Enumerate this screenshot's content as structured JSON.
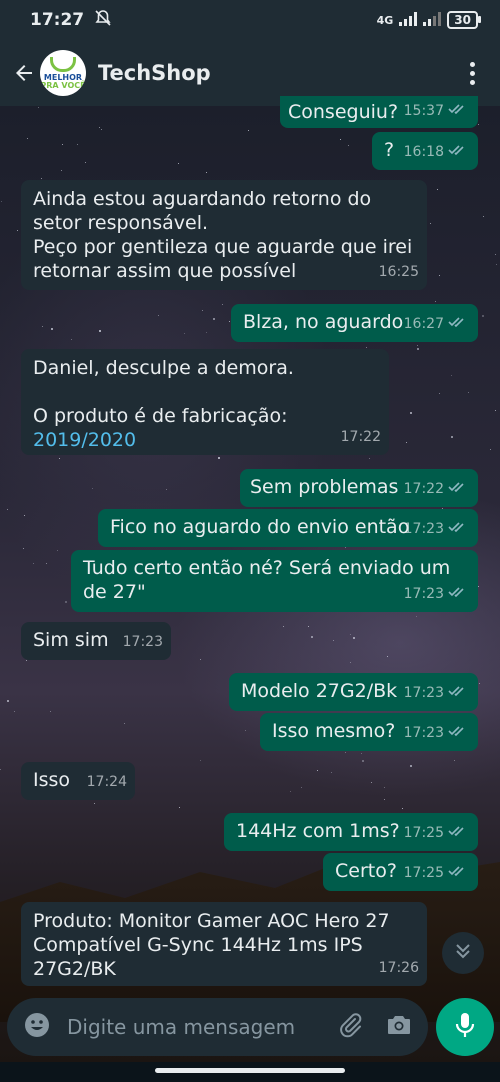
{
  "status_bar": {
    "time": "17:27",
    "network": "4G",
    "battery": "30"
  },
  "header": {
    "contact_name": "TechShop",
    "avatar_line1": "MELHOR",
    "avatar_line2": "PRA VOCÊ"
  },
  "messages": [
    {
      "dir": "out",
      "text": "Conseguiu?",
      "time": "15:37"
    },
    {
      "dir": "out",
      "text": "?",
      "time": "16:18"
    },
    {
      "dir": "in",
      "text": "Ainda estou aguardando retorno do setor responsável.\nPeço por gentileza que aguarde que irei retornar assim que possível",
      "time": "16:25"
    },
    {
      "dir": "out",
      "text": "Blza, no aguardo",
      "time": "16:27"
    },
    {
      "dir": "in",
      "text": "Daniel, desculpe a demora.\n\nO produto é de fabricação: ",
      "link": "2019/2020",
      "time": "17:22"
    },
    {
      "dir": "out",
      "text": "Sem problemas",
      "time": "17:22"
    },
    {
      "dir": "out",
      "text": "Fico no aguardo do envio então",
      "time": "17:23"
    },
    {
      "dir": "out",
      "text": "Tudo certo então né? Será enviado um de 27\"",
      "time": "17:23"
    },
    {
      "dir": "in",
      "text": "Sim sim",
      "time": "17:23"
    },
    {
      "dir": "out",
      "text": "Modelo 27G2/Bk",
      "time": "17:23"
    },
    {
      "dir": "out",
      "text": "Isso mesmo?",
      "time": "17:23"
    },
    {
      "dir": "in",
      "text": "Isso",
      "time": "17:24"
    },
    {
      "dir": "out",
      "text": "144Hz com 1ms?",
      "time": "17:25"
    },
    {
      "dir": "out",
      "text": "Certo?",
      "time": "17:25"
    },
    {
      "dir": "in",
      "text": "Produto: Monitor Gamer AOC Hero 27 Compatível G-Sync 144Hz 1ms IPS 27G2/BK",
      "time": "17:26"
    }
  ],
  "composer": {
    "placeholder": "Digite uma mensagem"
  },
  "colors": {
    "incoming": "#1f2c34",
    "outgoing": "#005c4b",
    "accent": "#00a884",
    "read_ticks": "#8fb8c2",
    "link": "#53bdeb"
  }
}
